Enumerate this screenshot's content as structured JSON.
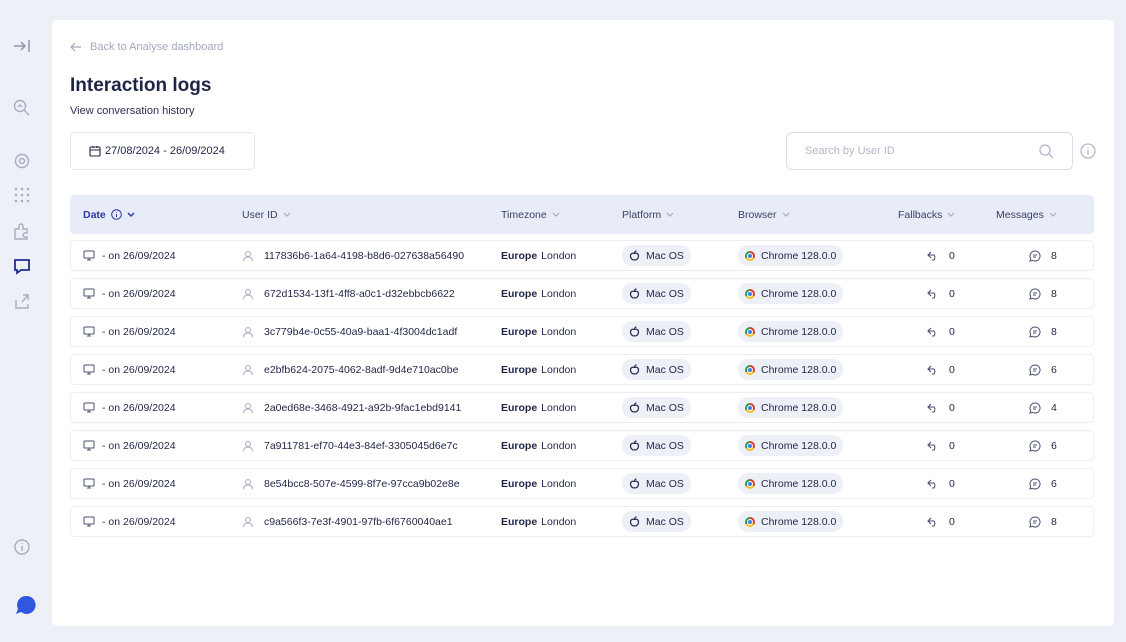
{
  "nav": {
    "back_label": "Back to Analyse dashboard"
  },
  "header": {
    "title": "Interaction logs",
    "subtitle": "View conversation history"
  },
  "filters": {
    "date_range": "27/08/2024 - 26/09/2024",
    "search_placeholder": "Search by User ID"
  },
  "table": {
    "columns": [
      "Date",
      "User ID",
      "Timezone",
      "Platform",
      "Browser",
      "Fallbacks",
      "Messages"
    ],
    "rows": [
      {
        "date": "- on 26/09/2024",
        "user_id": "117836b6-1a64-4198-b8d6-027638a56490",
        "tz_region": "Europe",
        "tz_city": "London",
        "platform": "Mac OS",
        "browser": "Chrome 128.0.0",
        "fallbacks": "0",
        "messages": "8"
      },
      {
        "date": "- on 26/09/2024",
        "user_id": "672d1534-13f1-4ff8-a0c1-d32ebbcb6622",
        "tz_region": "Europe",
        "tz_city": "London",
        "platform": "Mac OS",
        "browser": "Chrome 128.0.0",
        "fallbacks": "0",
        "messages": "8"
      },
      {
        "date": "- on 26/09/2024",
        "user_id": "3c779b4e-0c55-40a9-baa1-4f3004dc1adf",
        "tz_region": "Europe",
        "tz_city": "London",
        "platform": "Mac OS",
        "browser": "Chrome 128.0.0",
        "fallbacks": "0",
        "messages": "8"
      },
      {
        "date": "- on 26/09/2024",
        "user_id": "e2bfb624-2075-4062-8adf-9d4e710ac0be",
        "tz_region": "Europe",
        "tz_city": "London",
        "platform": "Mac OS",
        "browser": "Chrome 128.0.0",
        "fallbacks": "0",
        "messages": "6"
      },
      {
        "date": "- on 26/09/2024",
        "user_id": "2a0ed68e-3468-4921-a92b-9fac1ebd9141",
        "tz_region": "Europe",
        "tz_city": "London",
        "platform": "Mac OS",
        "browser": "Chrome 128.0.0",
        "fallbacks": "0",
        "messages": "4"
      },
      {
        "date": "- on 26/09/2024",
        "user_id": "7a911781-ef70-44e3-84ef-3305045d6e7c",
        "tz_region": "Europe",
        "tz_city": "London",
        "platform": "Mac OS",
        "browser": "Chrome 128.0.0",
        "fallbacks": "0",
        "messages": "6"
      },
      {
        "date": "- on 26/09/2024",
        "user_id": "8e54bcc8-507e-4599-8f7e-97cca9b02e8e",
        "tz_region": "Europe",
        "tz_city": "London",
        "platform": "Mac OS",
        "browser": "Chrome 128.0.0",
        "fallbacks": "0",
        "messages": "6"
      },
      {
        "date": "- on 26/09/2024",
        "user_id": "c9a566f3-7e3f-4901-97fb-6f6760040ae1",
        "tz_region": "Europe",
        "tz_city": "London",
        "platform": "Mac OS",
        "browser": "Chrome 128.0.0",
        "fallbacks": "0",
        "messages": "8"
      }
    ]
  },
  "sidebar": {
    "icons": [
      "collapse-sidebar-icon",
      "search-analytics-icon",
      "settings-icon",
      "grid-dots-icon",
      "plugin-icon",
      "conversations-icon",
      "share-icon",
      "info-icon",
      "chat-bubble-icon"
    ]
  },
  "colors": {
    "accent": "#2a3a9e",
    "header_bg": "#e8ecf8",
    "page_bg": "#eef0f8",
    "active_nav": "#1e2f8c"
  }
}
